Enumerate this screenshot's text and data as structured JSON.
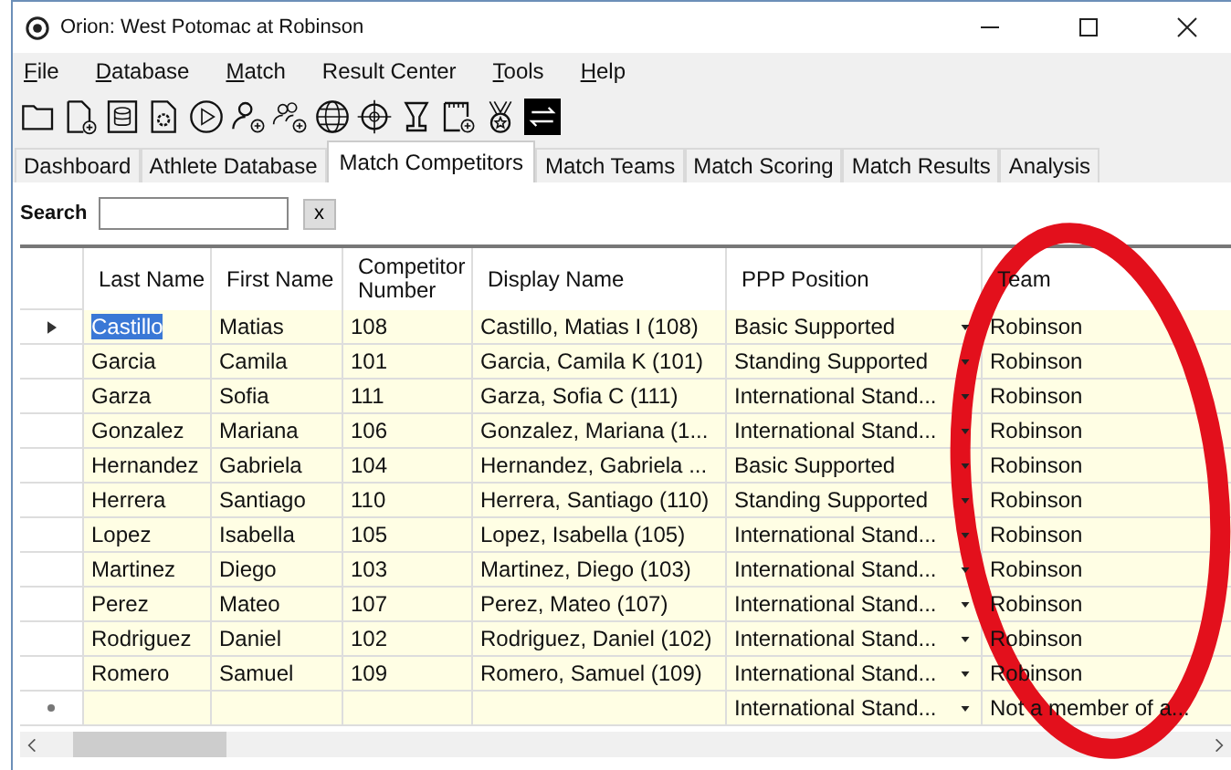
{
  "window": {
    "title": "Orion: West Potomac at Robinson"
  },
  "menu": [
    {
      "label": "File",
      "underline_first": true
    },
    {
      "label": "Database",
      "underline_first": true
    },
    {
      "label": "Match",
      "underline_first": true
    },
    {
      "label": "Result Center",
      "underline_first": false
    },
    {
      "label": "Tools",
      "underline_first": true
    },
    {
      "label": "Help",
      "underline_first": true
    }
  ],
  "tabs": [
    {
      "label": "Dashboard",
      "selected": false
    },
    {
      "label": "Athlete Database",
      "selected": false
    },
    {
      "label": "Match Competitors",
      "selected": true
    },
    {
      "label": "Match Teams",
      "selected": false
    },
    {
      "label": "Match Scoring",
      "selected": false
    },
    {
      "label": "Match Results",
      "selected": false
    },
    {
      "label": "Analysis",
      "selected": false
    }
  ],
  "search": {
    "label": "Search",
    "clear": "x"
  },
  "table": {
    "columns": [
      "Last Name",
      "First Name",
      "Competitor Number",
      "Display Name",
      "PPP Position",
      "Team"
    ],
    "rows": [
      {
        "current": true,
        "new": false,
        "cells": [
          "Castillo",
          "Matias",
          "108",
          "Castillo, Matias I (108)",
          "Basic Supported",
          "Robinson"
        ]
      },
      {
        "current": false,
        "new": false,
        "cells": [
          "Garcia",
          "Camila",
          "101",
          "Garcia, Camila K (101)",
          "Standing Supported",
          "Robinson"
        ]
      },
      {
        "current": false,
        "new": false,
        "cells": [
          "Garza",
          "Sofia",
          "111",
          "Garza, Sofia C (111)",
          "International Stand...",
          "Robinson"
        ]
      },
      {
        "current": false,
        "new": false,
        "cells": [
          "Gonzalez",
          "Mariana",
          "106",
          "Gonzalez, Mariana (1...",
          "International Stand...",
          "Robinson"
        ]
      },
      {
        "current": false,
        "new": false,
        "cells": [
          "Hernandez",
          "Gabriela",
          "104",
          "Hernandez, Gabriela ...",
          "Basic Supported",
          "Robinson"
        ]
      },
      {
        "current": false,
        "new": false,
        "cells": [
          "Herrera",
          "Santiago",
          "110",
          "Herrera, Santiago (110)",
          "Standing Supported",
          "Robinson"
        ]
      },
      {
        "current": false,
        "new": false,
        "cells": [
          "Lopez",
          "Isabella",
          "105",
          "Lopez, Isabella (105)",
          "International Stand...",
          "Robinson"
        ]
      },
      {
        "current": false,
        "new": false,
        "cells": [
          "Martinez",
          "Diego",
          "103",
          "Martinez, Diego (103)",
          "International Stand...",
          "Robinson"
        ]
      },
      {
        "current": false,
        "new": false,
        "cells": [
          "Perez",
          "Mateo",
          "107",
          "Perez, Mateo (107)",
          "International Stand...",
          "Robinson"
        ]
      },
      {
        "current": false,
        "new": false,
        "cells": [
          "Rodriguez",
          "Daniel",
          "102",
          "Rodriguez, Daniel (102)",
          "International Stand...",
          "Robinson"
        ]
      },
      {
        "current": false,
        "new": false,
        "cells": [
          "Romero",
          "Samuel",
          "109",
          "Romero, Samuel (109)",
          "International Stand...",
          "Robinson"
        ]
      },
      {
        "current": false,
        "new": true,
        "cells": [
          "",
          "",
          "",
          "",
          "International Stand...",
          "Not a member of a..."
        ]
      }
    ]
  }
}
